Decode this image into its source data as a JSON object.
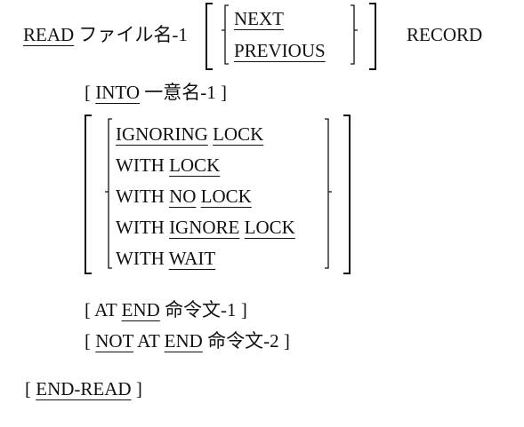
{
  "read_statement": {
    "read_kw": "READ",
    "file_name": "ファイル名-1",
    "direction_options": [
      "NEXT",
      "PREVIOUS"
    ],
    "record_kw": "RECORD"
  },
  "into_clause": {
    "open": "[",
    "into_kw": "INTO",
    "identifier": "一意名-1",
    "close": "]"
  },
  "lock_options": [
    [
      {
        "text": "IGNORING",
        "u": true
      },
      {
        "text": " ",
        "u": false
      },
      {
        "text": "LOCK",
        "u": true
      }
    ],
    [
      {
        "text": "WITH ",
        "u": false
      },
      {
        "text": "LOCK",
        "u": true
      }
    ],
    [
      {
        "text": "WITH ",
        "u": false
      },
      {
        "text": "NO",
        "u": true
      },
      {
        "text": " ",
        "u": false
      },
      {
        "text": "LOCK",
        "u": true
      }
    ],
    [
      {
        "text": "WITH ",
        "u": false
      },
      {
        "text": "IGNORE",
        "u": true
      },
      {
        "text": " ",
        "u": false
      },
      {
        "text": "LOCK",
        "u": true
      }
    ],
    [
      {
        "text": "WITH ",
        "u": false
      },
      {
        "text": "WAIT",
        "u": true
      }
    ]
  ],
  "at_end_clause": {
    "open": "[",
    "at": "AT",
    "end_kw": "END",
    "statement": "命令文-1",
    "close": "]"
  },
  "not_at_end_clause": {
    "open": "[",
    "not_kw": "NOT",
    "at": "AT",
    "end_kw": "END",
    "statement": "命令文-2",
    "close": "]"
  },
  "end_read_clause": {
    "open": "[",
    "end_read_kw": "END-READ",
    "close": "]"
  }
}
